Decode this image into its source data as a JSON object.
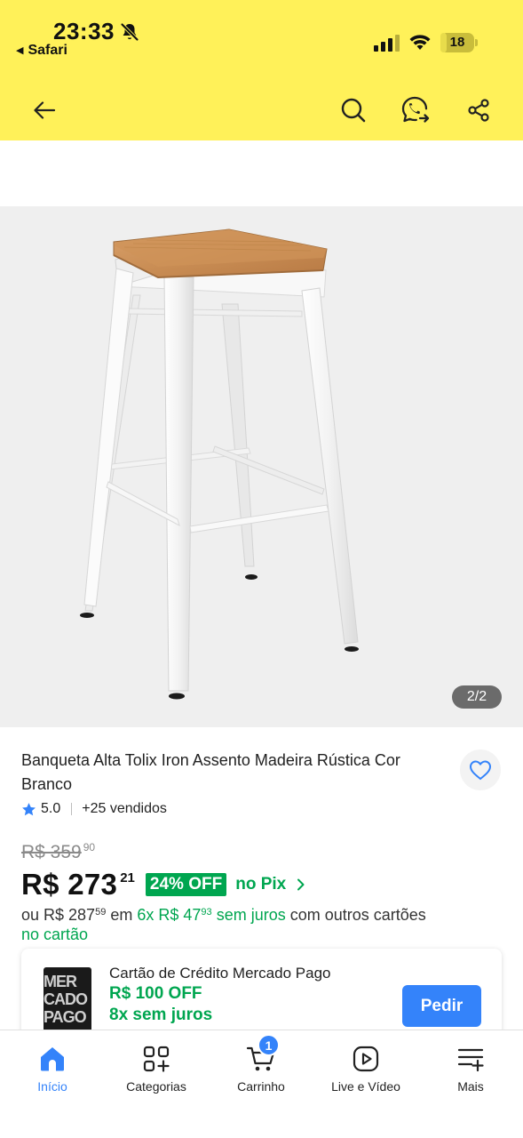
{
  "status_bar": {
    "time": "23:33",
    "back_app": "Safari",
    "battery": "18",
    "battery_level": 0.18
  },
  "header": {
    "back_icon": "arrow-left-icon",
    "search_icon": "search-icon",
    "chat_icon": "chat-icon",
    "share_icon": "share-icon",
    "background": "#fff159"
  },
  "gallery": {
    "counter": "2/2"
  },
  "product": {
    "title": "Banqueta Alta Tolix Iron Assento Madeira Rústica Cor Branco",
    "rating": "5.0",
    "sold": "+25 vendidos",
    "old_price": "R$ 359",
    "old_price_cents": "90",
    "price": "R$ 273",
    "price_cents": "21",
    "discount": "24% OFF",
    "pix_label": "no Pix",
    "installments": {
      "prefix": "ou R$ 287",
      "prefix_cents": "59",
      "em": "em",
      "plan": "6x R$ 47",
      "plan_cents": "93",
      "no_interest": "sem juros",
      "suffix": "com outros cartões",
      "second_line": "no cartão"
    }
  },
  "card_promo": {
    "image_text": [
      "MER",
      "CADO",
      "PAGO"
    ],
    "title": "Cartão de Crédito Mercado Pago",
    "off": "R$ 100 OFF",
    "installments": "8x sem juros",
    "button": "Pedir"
  },
  "bottom_nav": {
    "items": [
      {
        "label": "Início",
        "icon": "home-icon",
        "active": true
      },
      {
        "label": "Categorias",
        "icon": "categories-icon",
        "active": false
      },
      {
        "label": "Carrinho",
        "icon": "cart-icon",
        "active": false
      },
      {
        "label": "Live e Vídeo",
        "icon": "play-icon",
        "active": false
      },
      {
        "label": "Mais",
        "icon": "more-icon",
        "active": false
      }
    ],
    "cart_count": "1"
  },
  "colors": {
    "accent": "#3483fa",
    "green": "#00a650",
    "header_yellow": "#fff159"
  }
}
